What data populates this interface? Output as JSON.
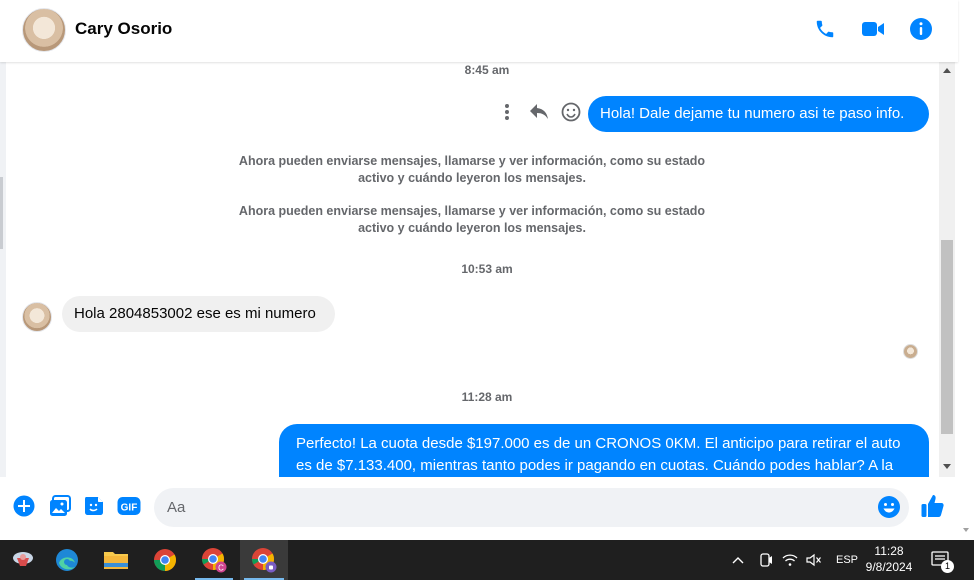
{
  "contact": {
    "name": "Cary Osorio"
  },
  "conversation": {
    "timestamps": [
      "8:45 am",
      "10:53 am",
      "11:28 am"
    ],
    "outgoing_1": "Hola! Dale dejame tu numero  asi te paso info.",
    "system_1_line1": "Ahora pueden enviarse mensajes, llamarse y ver información, como su estado",
    "system_1_line2": "activo y cuándo leyeron los mensajes.",
    "system_2_line1": "Ahora pueden enviarse mensajes, llamarse y ver información, como su estado",
    "system_2_line2": "activo y cuándo leyeron los mensajes.",
    "incoming_1": "Hola 2804853002  ese es mi numero",
    "outgoing_2_line1": "Perfecto! La cuota desde $197.000 es de un CRONOS 0KM. El anticipo para retirar el auto",
    "outgoing_2_line2": "es de $7.133.400, mientras tanto podes ir pagando en cuotas. Cuándo podes hablar? A la"
  },
  "composer": {
    "placeholder": "Aa"
  },
  "taskbar": {
    "language": "ESP",
    "time": "11:28",
    "date": "9/8/2024",
    "notification_count": "1"
  },
  "colors": {
    "accent": "#0084ff",
    "bubble_in": "#f0f0f0",
    "taskbar": "#1f1f1f"
  }
}
